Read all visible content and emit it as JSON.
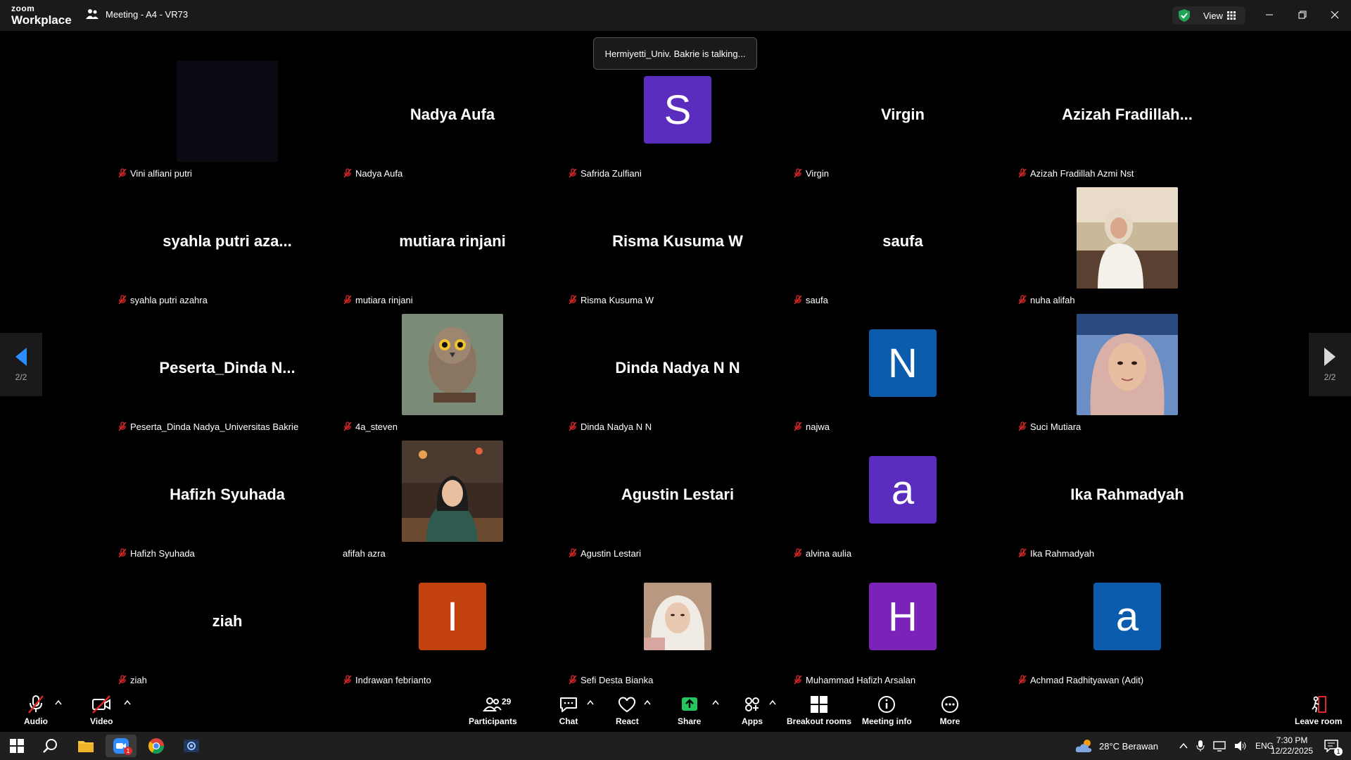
{
  "titlebar": {
    "logo_line1": "zoom",
    "logo_line2": "Workplace",
    "meeting_title": "Meeting - A4 - VR73",
    "view_label": "View"
  },
  "talking_indicator": "Hermiyetti_Univ. Bakrie is talking...",
  "participants_grid": [
    {
      "display": "Vini alfiani putri",
      "label": "Vini alfiani putri",
      "muted": true,
      "type": "video"
    },
    {
      "display": "Nadya Aufa",
      "label": "Nadya Aufa",
      "muted": true,
      "type": "name"
    },
    {
      "display": "S",
      "label": "Safrida Zulfiani",
      "muted": true,
      "type": "avatar",
      "color": "#5b2dbf"
    },
    {
      "display": "Virgin",
      "label": "Virgin",
      "muted": true,
      "type": "name"
    },
    {
      "display": "Azizah  Fradillah...",
      "label": "Azizah Fradillah Azmi Nst",
      "muted": true,
      "type": "name"
    },
    {
      "display": "syahla putri aza...",
      "label": "syahla putri azahra",
      "muted": true,
      "type": "name"
    },
    {
      "display": "mutiara rinjani",
      "label": "mutiara rinjani",
      "muted": true,
      "type": "name"
    },
    {
      "display": "Risma Kusuma W",
      "label": "Risma Kusuma W",
      "muted": true,
      "type": "name"
    },
    {
      "display": "saufa",
      "label": "saufa",
      "muted": true,
      "type": "name"
    },
    {
      "display": "nuha alifah",
      "label": "nuha alifah",
      "muted": true,
      "type": "photo",
      "photo": "hijab-white"
    },
    {
      "display": "Peserta_Dinda  N...",
      "label": "Peserta_Dinda Nadya_Universitas Bakrie",
      "muted": true,
      "type": "name"
    },
    {
      "display": "4a_steven",
      "label": "4a_steven",
      "muted": true,
      "type": "photo",
      "photo": "owl"
    },
    {
      "display": "Dinda Nadya N N",
      "label": "Dinda Nadya N N",
      "muted": true,
      "type": "name"
    },
    {
      "display": "N",
      "label": "najwa",
      "muted": true,
      "type": "avatar",
      "color": "#0b5cad"
    },
    {
      "display": "Suci Mutiara",
      "label": "Suci Mutiara",
      "muted": true,
      "type": "photo",
      "photo": "hijab-pink"
    },
    {
      "display": "Hafizh Syuhada",
      "label": "Hafizh Syuhada",
      "muted": true,
      "type": "name"
    },
    {
      "display": "afifah azra",
      "label": "afifah azra",
      "muted": false,
      "type": "photo",
      "photo": "cafe"
    },
    {
      "display": "Agustin Lestari",
      "label": "Agustin Lestari",
      "muted": true,
      "type": "name"
    },
    {
      "display": "a",
      "label": "alvina aulia",
      "muted": true,
      "type": "avatar",
      "color": "#5b2dbf"
    },
    {
      "display": "Ika Rahmadyah",
      "label": "Ika Rahmadyah",
      "muted": true,
      "type": "name"
    },
    {
      "display": "ziah",
      "label": "ziah",
      "muted": true,
      "type": "name"
    },
    {
      "display": "I",
      "label": "Indrawan febrianto",
      "muted": true,
      "type": "avatar",
      "color": "#c2410c"
    },
    {
      "display": "Sefi Desta Bianka",
      "label": "Sefi Desta Bianka",
      "muted": true,
      "type": "photo",
      "photo": "selfie"
    },
    {
      "display": "H",
      "label": "Muhammad Hafizh Arsalan",
      "muted": true,
      "type": "avatar",
      "color": "#7b22b8"
    },
    {
      "display": "a",
      "label": "Achmad Radhityawan (Adit)",
      "muted": true,
      "type": "avatar",
      "color": "#0b5cad"
    }
  ],
  "pagination": {
    "left": "2/2",
    "right": "2/2"
  },
  "toolbar": {
    "audio": "Audio",
    "video": "Video",
    "participants": "Participants",
    "participants_count": "29",
    "chat": "Chat",
    "react": "React",
    "share": "Share",
    "apps": "Apps",
    "breakout": "Breakout rooms",
    "meeting_info": "Meeting info",
    "more": "More",
    "leave": "Leave room"
  },
  "taskbar": {
    "weather": "28°C  Berawan",
    "lang": "ENG",
    "time": "7:30 PM",
    "date": "12/22/2025",
    "zoom_badge": "1",
    "notif_badge": "1"
  },
  "colors": {
    "mute": "#e02828",
    "share_green": "#22c55e",
    "shield_green": "#22a35a",
    "nav_blue": "#2d8cff"
  }
}
